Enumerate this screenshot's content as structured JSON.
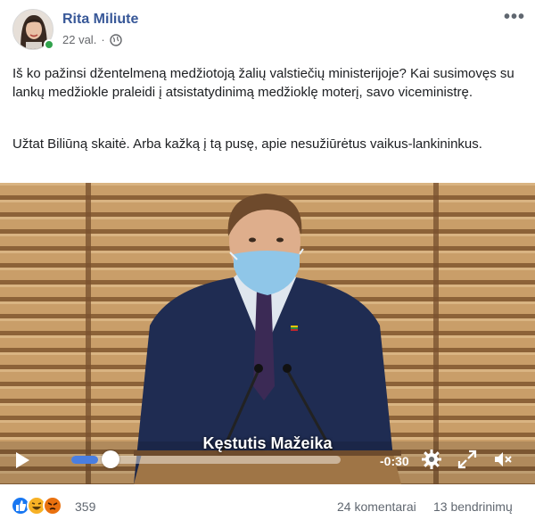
{
  "post": {
    "author": "Rita Miliute",
    "time": "22 val.",
    "time_separator": "·",
    "privacy_icon": "globe-icon",
    "more_label": "•••",
    "paragraph_1": "Iš ko pažinsi džentelmeną medžiotoją žalių valstiečių ministerijoje? Kai susimovęs su lankų medžiokle praleidi į atsistatydinimą medžioklę moterį, savo viceministrę.",
    "paragraph_2": "Užtat Biliūną skaitė. Arba kažką į tą pusę, apie nesužiūrėtus vaikus-lankininkus."
  },
  "video": {
    "caption": "Kęstutis Mažeika",
    "time_remaining": "-0:30",
    "progress": 0.1,
    "icons": [
      "play-icon",
      "settings-gear-icon",
      "fullscreen-icon",
      "volume-icon"
    ]
  },
  "footer": {
    "reaction_icons": [
      "like-icon",
      "haha-icon",
      "angry-icon"
    ],
    "reaction_count": "359",
    "comments": "24 komentarai",
    "shares": "13 bendrinimų"
  },
  "colors": {
    "author": "#385898",
    "like": "#1877f2",
    "haha": "#f7b125",
    "angry": "#e9710f",
    "progress": "#4a7ee0",
    "online": "#31a24c"
  }
}
